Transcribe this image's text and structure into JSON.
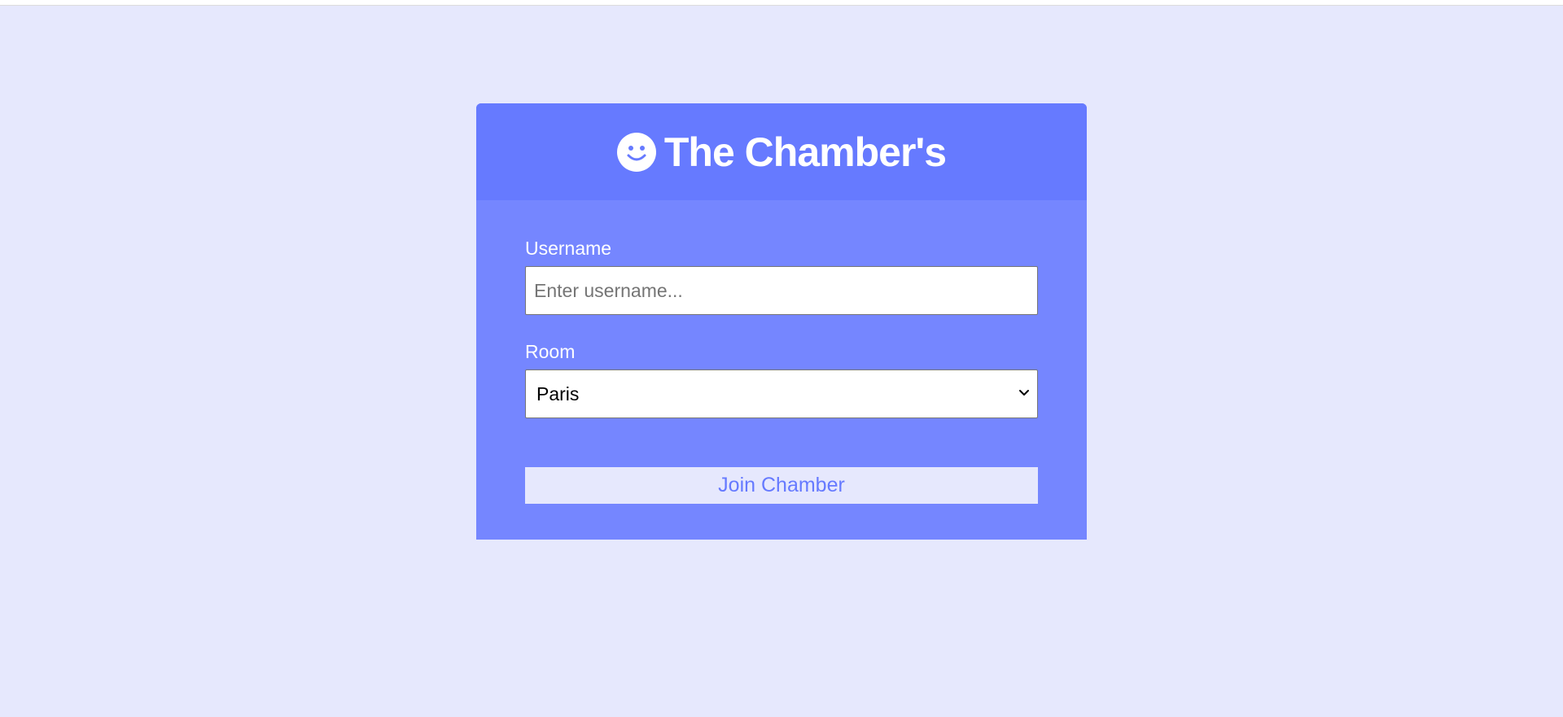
{
  "colors": {
    "page_background": "#e6e8fd",
    "card_header": "#667aff",
    "card_body": "#7586ff",
    "button_background": "#e6e8fd",
    "button_text": "#667aff"
  },
  "header": {
    "icon": "smiley-face-icon",
    "title": "The Chamber's"
  },
  "form": {
    "username_label": "Username",
    "username_placeholder": "Enter username...",
    "username_value": "",
    "room_label": "Room",
    "room_selected": "Paris",
    "room_icon": "chevron-down-icon",
    "submit_label": "Join Chamber"
  }
}
